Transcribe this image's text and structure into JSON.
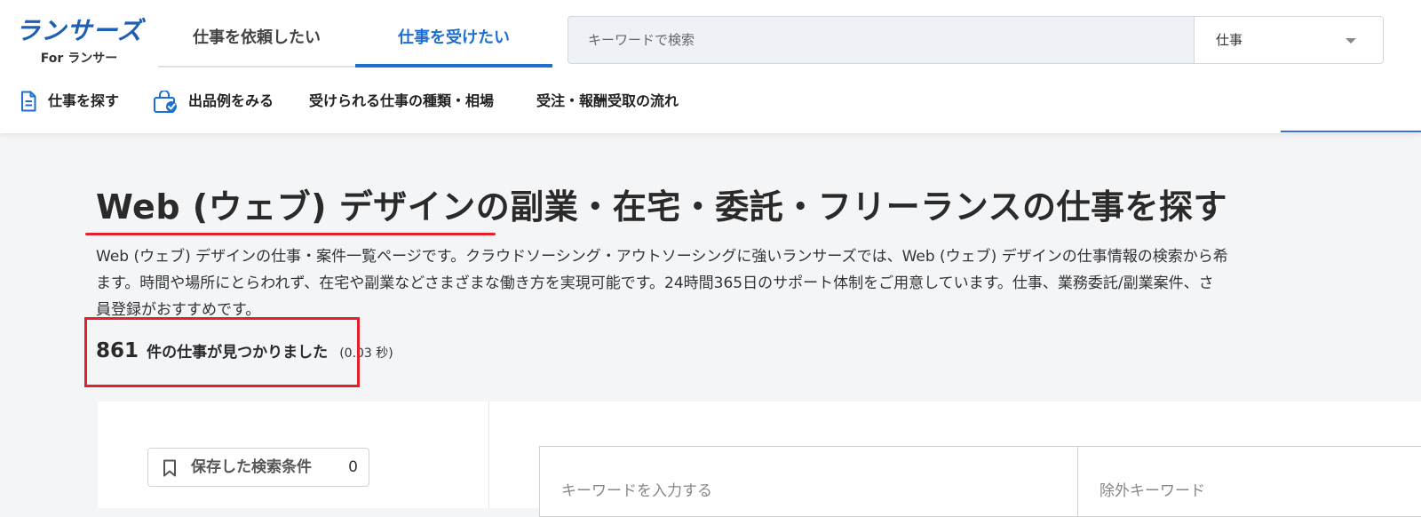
{
  "header": {
    "logo": {
      "main": "ランサーズ",
      "sub": "For ランサー"
    },
    "tabs": [
      {
        "label": "仕事を依頼したい",
        "active": false
      },
      {
        "label": "仕事を受けたい",
        "active": true
      }
    ],
    "search": {
      "placeholder": "キーワードで検索",
      "category": "仕事"
    },
    "subnav": [
      {
        "label": "仕事を探す",
        "icon": "document-icon"
      },
      {
        "label": "出品例をみる",
        "icon": "shopping-bag-icon"
      },
      {
        "label": "受けられる仕事の種類・相場"
      },
      {
        "label": "受注・報酬受取の流れ"
      }
    ]
  },
  "main": {
    "title": "Web (ウェブ) デザインの副業・在宅・委託・フリーランスの仕事を探す",
    "description_lines": [
      "Web (ウェブ) デザインの仕事・案件一覧ページです。クラウドソーシング・アウトソーシングに強いランサーズでは、Web (ウェブ) デザインの仕事情報の検索から希",
      "ます。時間や場所にとらわれず、在宅や副業などさまざまな働き方を実現可能です。24時間365日のサポート体制をご用意しています。仕事、業務委託/副業案件、さ",
      "員登録がおすすめです。"
    ],
    "result": {
      "count": "861",
      "label": "件の仕事が見つかりました",
      "time": "(0.03 秒)"
    },
    "saved_search": {
      "label": "保存した検索条件",
      "count": "0"
    },
    "keyword_input": {
      "placeholder": "キーワードを入力する"
    },
    "exclude_input": {
      "placeholder": "除外キーワード"
    }
  },
  "colors": {
    "brand": "#1d5fb3",
    "active_tab": "#1d6fd1",
    "highlight": "#e5202d"
  }
}
